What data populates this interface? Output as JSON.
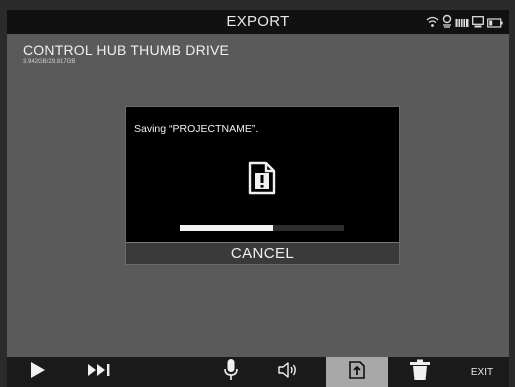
{
  "header": {
    "title": "EXPORT",
    "status_icons": [
      "wifi-icon",
      "gps-icon",
      "storage-icon",
      "monitor-icon",
      "battery-icon"
    ]
  },
  "drive": {
    "name": "CONTROL HUB THUMB DRIVE",
    "usage": "3.942GB/29.817GB"
  },
  "dialog": {
    "message": "Saving “PROJECTNAME”.",
    "icon": "document-alert-icon",
    "progress": 0.57,
    "cancel_label": "CANCEL"
  },
  "toolbar": {
    "buttons": [
      "play-icon",
      "skip-forward-icon",
      "microphone-icon",
      "speaker-icon",
      "export-icon",
      "trash-icon"
    ],
    "active_button": "export-icon",
    "exit_label": "EXIT"
  },
  "colors": {
    "background": "#5a5a5a",
    "bars": "#111111",
    "dialog": "#000000",
    "active_tab": "#a8a8a8"
  }
}
